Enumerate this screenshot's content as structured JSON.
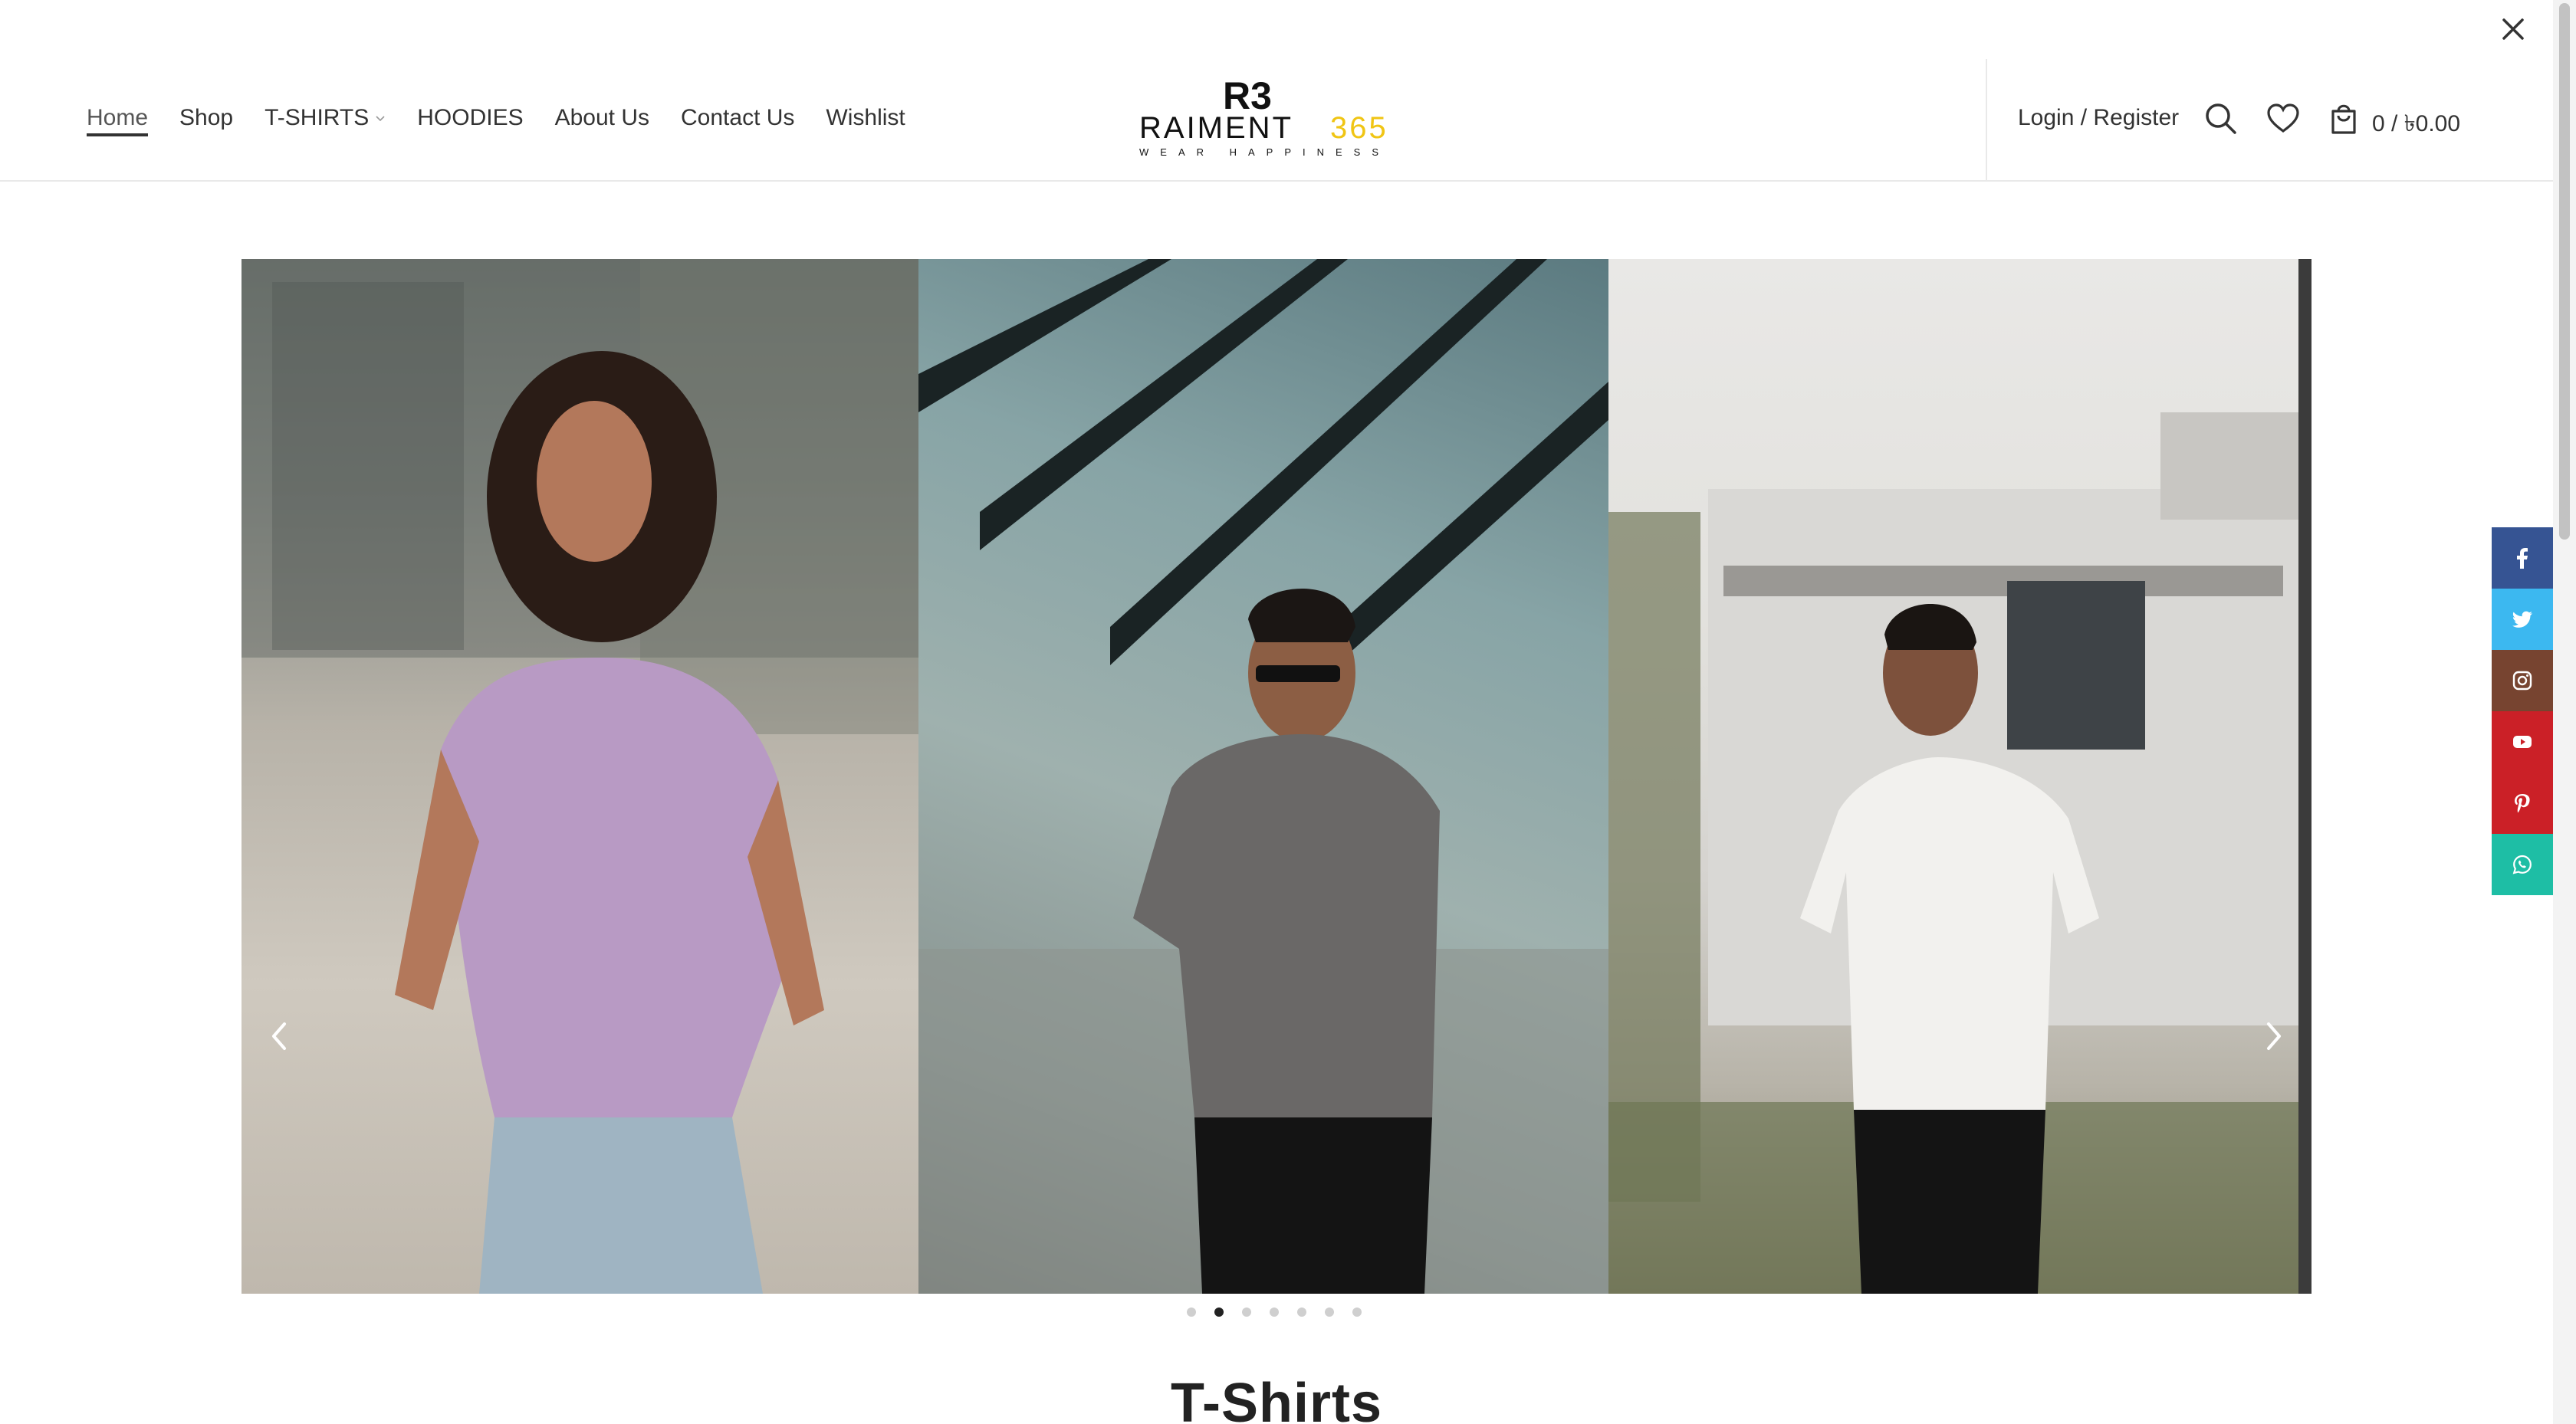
{
  "nav": {
    "items": [
      {
        "label": "Home",
        "active": true
      },
      {
        "label": "Shop"
      },
      {
        "label": "T-SHIRTS",
        "has_dropdown": true
      },
      {
        "label": "HOODIES"
      },
      {
        "label": "About Us"
      },
      {
        "label": "Contact Us"
      },
      {
        "label": "Wishlist"
      }
    ]
  },
  "logo": {
    "mark": "R3",
    "brand_left": "RAIMENT",
    "brand_right": "365",
    "tagline": "WEAR HAPPINESS",
    "accent_color": "#f0c514"
  },
  "header": {
    "account_label": "Login / Register",
    "cart_total": "0 / ৳0.00",
    "icons": [
      "search-icon",
      "heart-icon",
      "cart-icon"
    ]
  },
  "slider": {
    "dot_count": 7,
    "active_index": 1
  },
  "section": {
    "title": "T-Shirts"
  },
  "social": [
    {
      "name": "facebook",
      "color": "#365493"
    },
    {
      "name": "twitter",
      "color": "#3cb8f0"
    },
    {
      "name": "instagram",
      "color": "#774430"
    },
    {
      "name": "youtube",
      "color": "#cb2027"
    },
    {
      "name": "pinterest",
      "color": "#cb2027"
    },
    {
      "name": "whatsapp",
      "color": "#1ebea5"
    }
  ]
}
